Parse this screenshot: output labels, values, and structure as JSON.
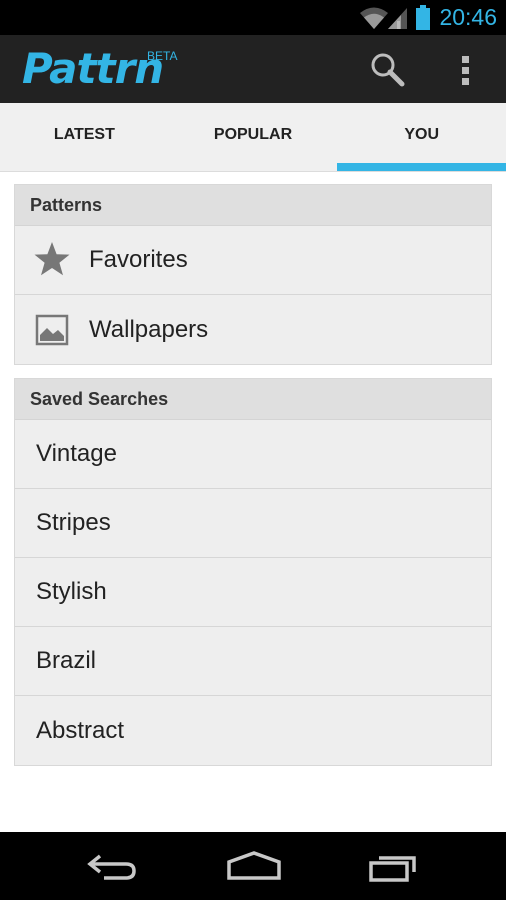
{
  "status_bar": {
    "time": "20:46"
  },
  "app": {
    "title": "Pattrn",
    "badge": "BETA"
  },
  "tabs": [
    {
      "label": "LATEST",
      "active": false
    },
    {
      "label": "POPULAR",
      "active": false
    },
    {
      "label": "YOU",
      "active": true
    }
  ],
  "patterns_section": {
    "header": "Patterns",
    "items": [
      {
        "label": "Favorites",
        "icon": "star-icon"
      },
      {
        "label": "Wallpapers",
        "icon": "picture-icon"
      }
    ]
  },
  "saved_searches_section": {
    "header": "Saved Searches",
    "items": [
      {
        "label": "Vintage"
      },
      {
        "label": "Stripes"
      },
      {
        "label": "Stylish"
      },
      {
        "label": "Brazil"
      },
      {
        "label": "Abstract"
      }
    ]
  },
  "colors": {
    "accent": "#33b5e5",
    "action_bar": "#222222",
    "status_bar": "#000000"
  }
}
